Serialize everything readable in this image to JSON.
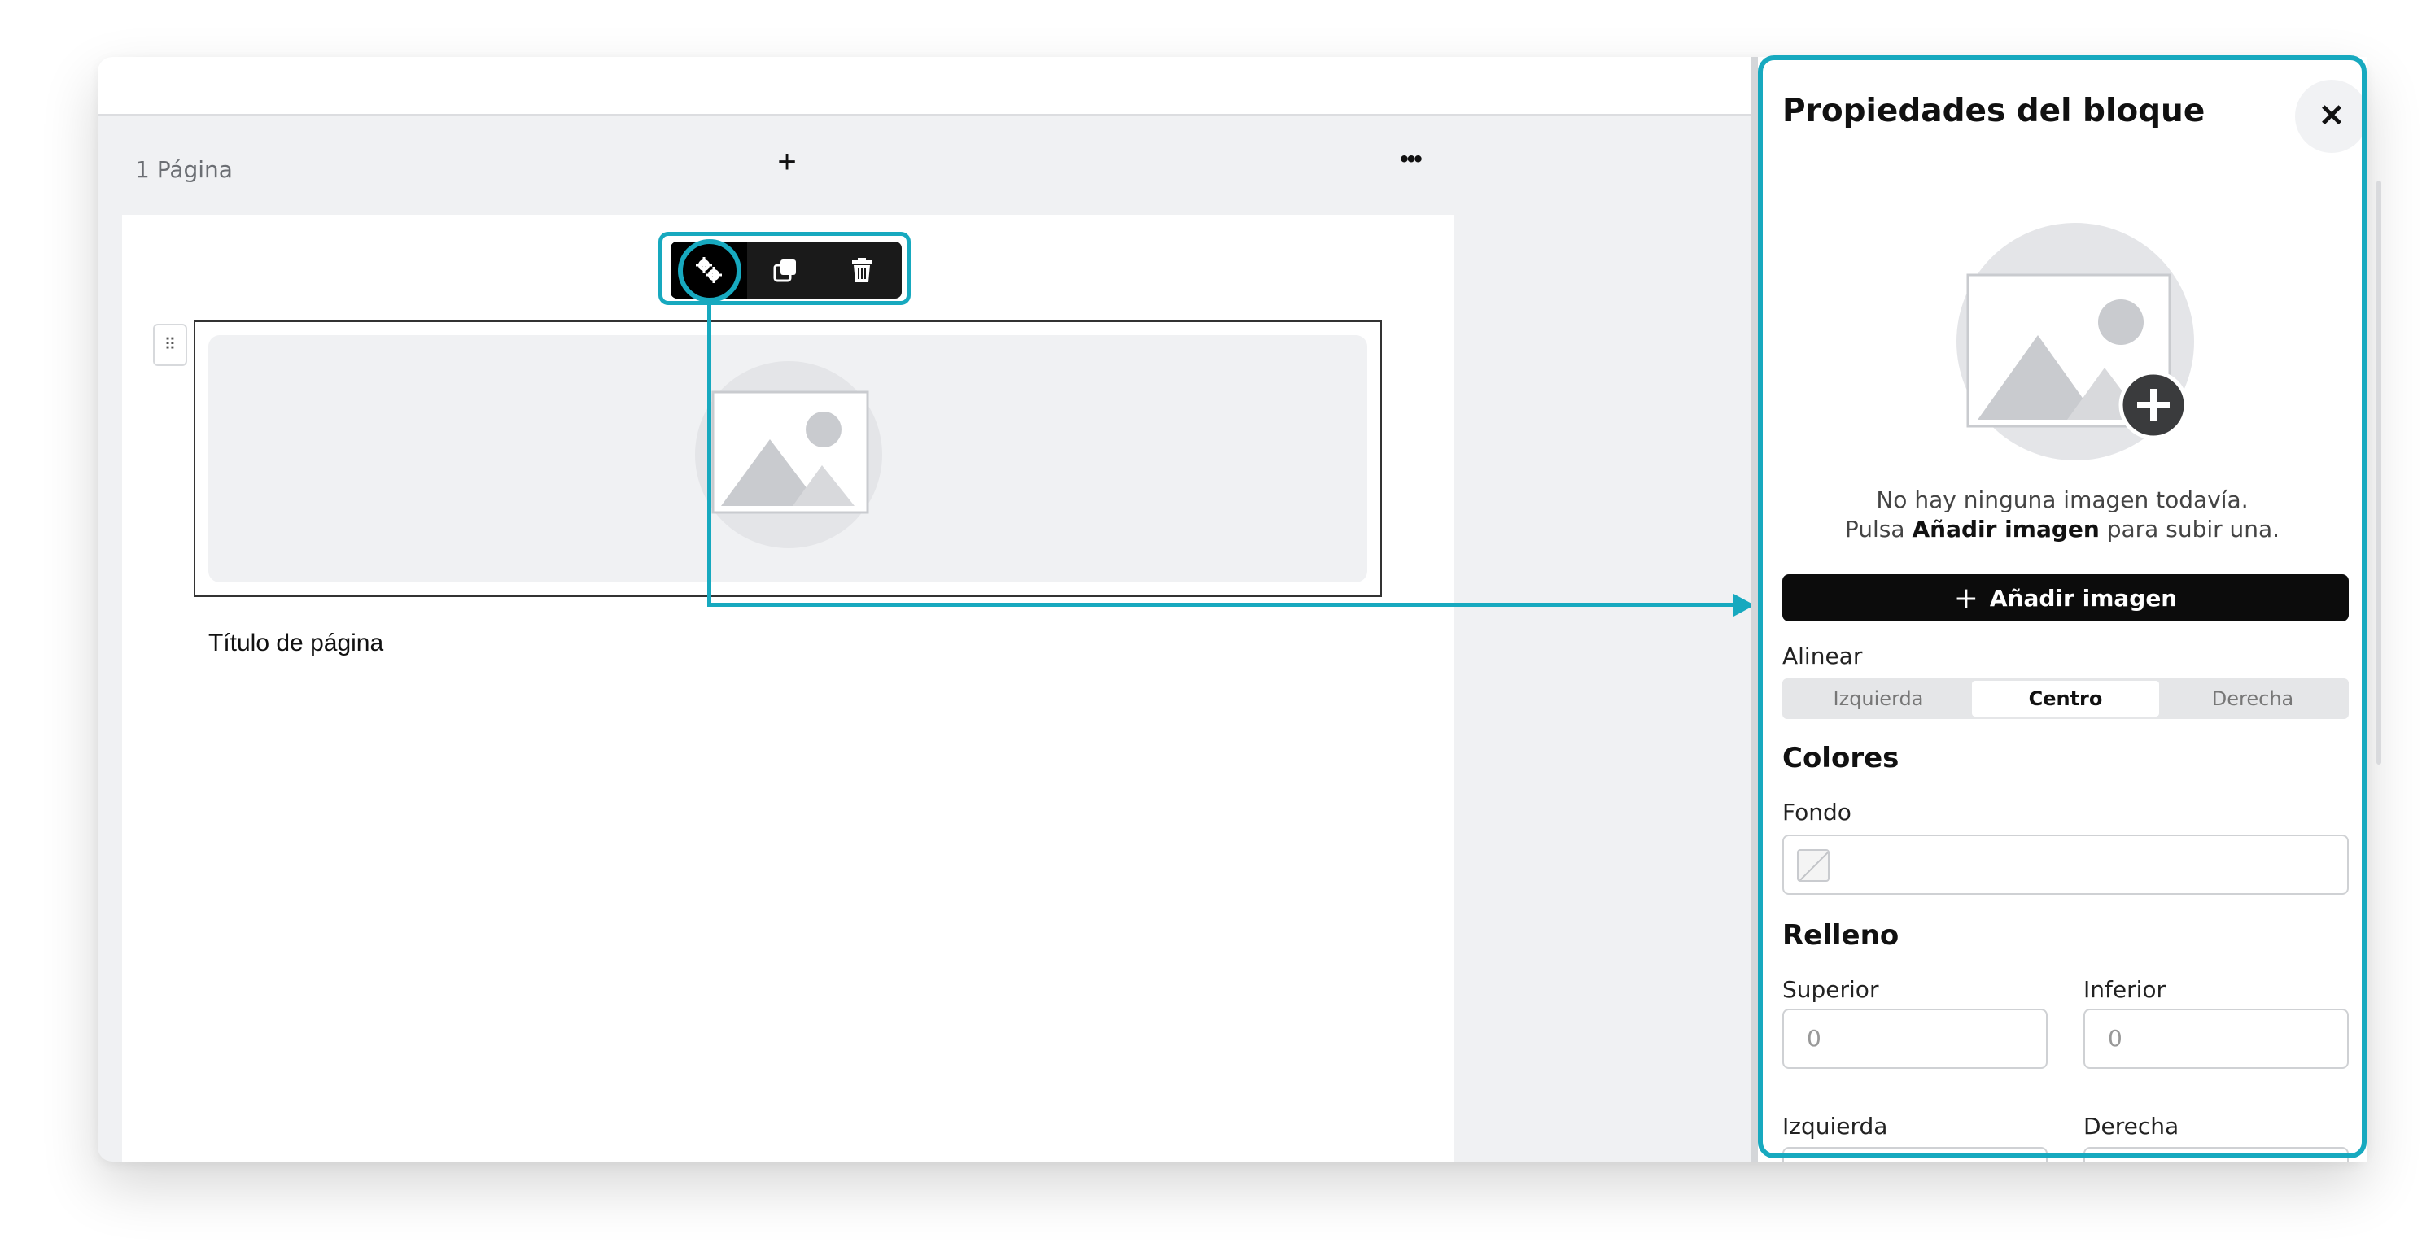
{
  "editor": {
    "page_count_label": "1 Página",
    "add_page_icon": "plus-icon",
    "more_icon": "ellipsis-icon",
    "page_title": "Título de página",
    "block_toolbar": {
      "settings_icon": "gears-icon",
      "duplicate_icon": "duplicate-icon",
      "delete_icon": "trash-icon"
    },
    "drag_handle_icon": "drag-handle-icon",
    "drag_handle_glyph": "⠿"
  },
  "panel": {
    "title": "Propiedades del bloque",
    "close_glyph": "✕",
    "empty_line1": "No hay ninguna imagen todavía.",
    "empty_line2_prefix": "Pulsa",
    "empty_line2_bold": "Añadir imagen",
    "empty_line2_suffix": "para subir una.",
    "add_image_label": "Añadir imagen",
    "align": {
      "label": "Alinear",
      "options": [
        "Izquierda",
        "Centro",
        "Derecha"
      ],
      "selected": "Centro"
    },
    "colors": {
      "heading": "Colores",
      "background_label": "Fondo"
    },
    "padding": {
      "heading": "Relleno",
      "top_label": "Superior",
      "top_placeholder": "0",
      "bottom_label": "Inferior",
      "bottom_placeholder": "0",
      "left_label": "Izquierda",
      "right_label": "Derecha"
    }
  },
  "colors": {
    "highlight": "#17a9bf",
    "button_dark": "#0c0c0c"
  }
}
